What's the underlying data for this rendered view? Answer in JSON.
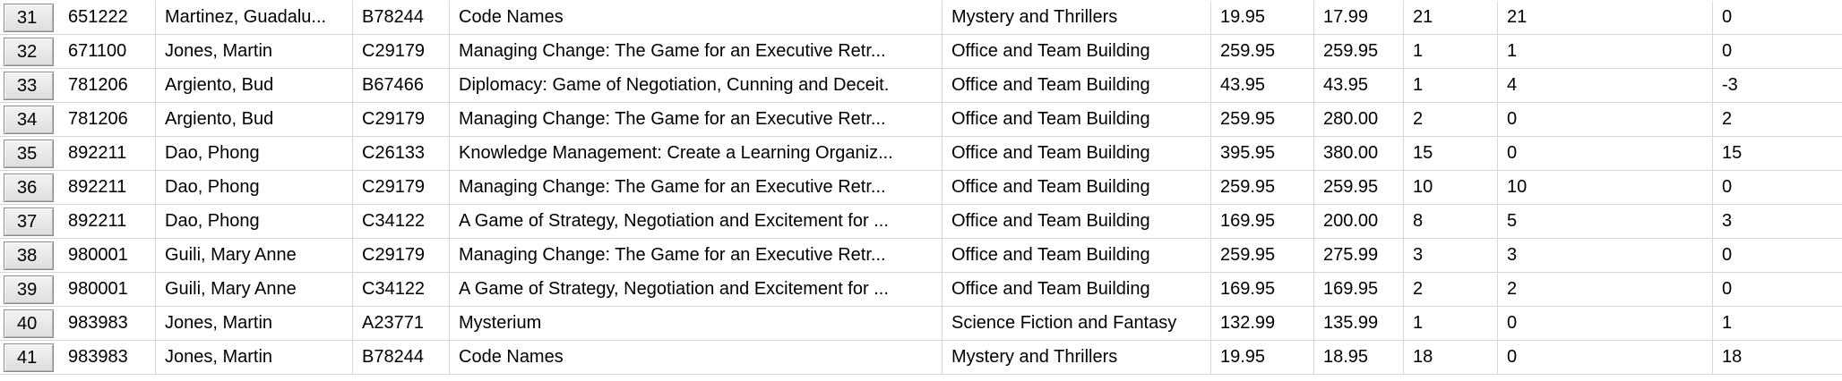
{
  "grid": {
    "rows": [
      {
        "num": "31",
        "id": "651222",
        "name": "Martinez, Guadalu...",
        "code": "B78244",
        "title": "Code Names",
        "category": "Mystery and Thrillers",
        "price1": "19.95",
        "price2": "17.99",
        "qty1": "21",
        "qty2": "21",
        "diff": "0"
      },
      {
        "num": "32",
        "id": "671100",
        "name": "Jones, Martin",
        "code": "C29179",
        "title": "Managing Change: The Game for an Executive Retr...",
        "category": "Office and Team Building",
        "price1": "259.95",
        "price2": "259.95",
        "qty1": "1",
        "qty2": "1",
        "diff": "0"
      },
      {
        "num": "33",
        "id": "781206",
        "name": "Argiento, Bud",
        "code": "B67466",
        "title": "Diplomacy: Game of Negotiation, Cunning and Deceit.",
        "category": "Office and Team Building",
        "price1": "43.95",
        "price2": "43.95",
        "qty1": "1",
        "qty2": "4",
        "diff": "-3"
      },
      {
        "num": "34",
        "id": "781206",
        "name": "Argiento, Bud",
        "code": "C29179",
        "title": "Managing Change: The Game for an Executive Retr...",
        "category": "Office and Team Building",
        "price1": "259.95",
        "price2": "280.00",
        "qty1": "2",
        "qty2": "0",
        "diff": "2"
      },
      {
        "num": "35",
        "id": "892211",
        "name": "Dao, Phong",
        "code": "C26133",
        "title": "Knowledge Management: Create a Learning Organiz...",
        "category": "Office and Team Building",
        "price1": "395.95",
        "price2": "380.00",
        "qty1": "15",
        "qty2": "0",
        "diff": "15"
      },
      {
        "num": "36",
        "id": "892211",
        "name": "Dao, Phong",
        "code": "C29179",
        "title": "Managing Change: The Game for an Executive Retr...",
        "category": "Office and Team Building",
        "price1": "259.95",
        "price2": "259.95",
        "qty1": "10",
        "qty2": "10",
        "diff": "0"
      },
      {
        "num": "37",
        "id": "892211",
        "name": "Dao, Phong",
        "code": "C34122",
        "title": "A Game of Strategy, Negotiation and Excitement for ...",
        "category": "Office and Team Building",
        "price1": "169.95",
        "price2": "200.00",
        "qty1": "8",
        "qty2": "5",
        "diff": "3"
      },
      {
        "num": "38",
        "id": "980001",
        "name": "Guili, Mary Anne",
        "code": "C29179",
        "title": "Managing Change: The Game for an Executive Retr...",
        "category": "Office and Team Building",
        "price1": "259.95",
        "price2": "275.99",
        "qty1": "3",
        "qty2": "3",
        "diff": "0"
      },
      {
        "num": "39",
        "id": "980001",
        "name": "Guili, Mary Anne",
        "code": "C34122",
        "title": "A Game of Strategy, Negotiation and Excitement for ...",
        "category": "Office and Team Building",
        "price1": "169.95",
        "price2": "169.95",
        "qty1": "2",
        "qty2": "2",
        "diff": "0"
      },
      {
        "num": "40",
        "id": "983983",
        "name": "Jones, Martin",
        "code": "A23771",
        "title": "Mysterium",
        "category": "Science Fiction and Fantasy",
        "price1": "132.99",
        "price2": "135.99",
        "qty1": "1",
        "qty2": "0",
        "diff": "1"
      },
      {
        "num": "41",
        "id": "983983",
        "name": "Jones, Martin",
        "code": "B78244",
        "title": "Code Names",
        "category": "Mystery and Thrillers",
        "price1": "19.95",
        "price2": "18.95",
        "qty1": "18",
        "qty2": "0",
        "diff": "18"
      }
    ]
  }
}
